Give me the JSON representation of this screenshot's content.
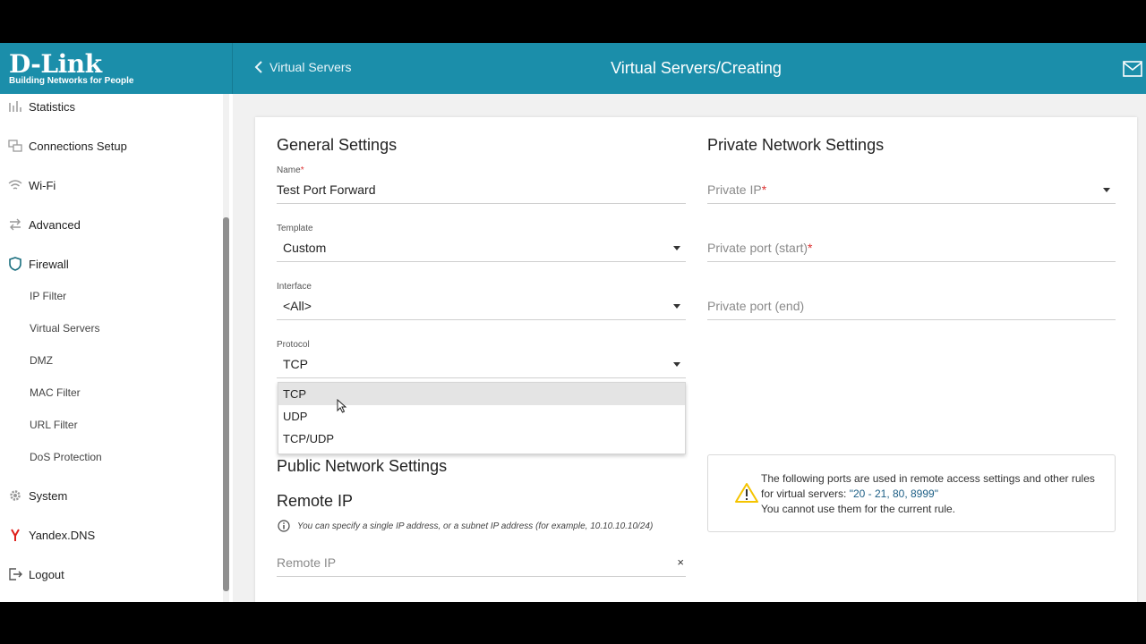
{
  "brand": {
    "name": "D-Link",
    "tagline": "Building Networks for People"
  },
  "header": {
    "back_label": "Virtual Servers",
    "title": "Virtual Servers/Creating",
    "mail_icon": "mail-icon"
  },
  "sidebar": {
    "items": [
      {
        "label": "Statistics",
        "icon": "bar-chart-icon"
      },
      {
        "label": "Connections Setup",
        "icon": "connections-icon"
      },
      {
        "label": "Wi-Fi",
        "icon": "wifi-icon"
      },
      {
        "label": "Advanced",
        "icon": "arrows-icon"
      },
      {
        "label": "Firewall",
        "icon": "shield-icon"
      },
      {
        "label": "System",
        "icon": "gear-icon"
      },
      {
        "label": "Yandex.DNS",
        "icon": "yandex-icon"
      },
      {
        "label": "Logout",
        "icon": "logout-icon"
      }
    ],
    "firewall_sub": [
      "IP Filter",
      "Virtual Servers",
      "DMZ",
      "MAC Filter",
      "URL Filter",
      "DoS Protection"
    ]
  },
  "general": {
    "title": "General Settings",
    "name_label": "Name",
    "name_value": "Test Port Forward",
    "template_label": "Template",
    "template_value": "Custom",
    "interface_label": "Interface",
    "interface_value": "<All>",
    "protocol_label": "Protocol",
    "protocol_value": "TCP",
    "protocol_options": [
      "TCP",
      "UDP",
      "TCP/UDP"
    ],
    "protocol_highlighted": "TCP"
  },
  "public": {
    "title": "Public Network Settings",
    "remote_title": "Remote IP",
    "hint": "You can specify a single IP address, or a subnet IP address (for example, 10.10.10.10/24)",
    "remote_placeholder": "Remote IP",
    "clear_label": "×"
  },
  "private": {
    "title": "Private Network Settings",
    "private_ip_placeholder": "Private IP",
    "port_start_placeholder": "Private port (start)",
    "port_end_placeholder": "Private port (end)"
  },
  "warning": {
    "line1": "The following ports are used in remote access settings and other rules for virtual servers:",
    "ports": "\"20 - 21, 80, 8999\"",
    "line2": "You cannot use them for the current rule."
  },
  "colors": {
    "accent": "#1b8eaa",
    "required": "#d33",
    "warning": "#f5c400"
  }
}
